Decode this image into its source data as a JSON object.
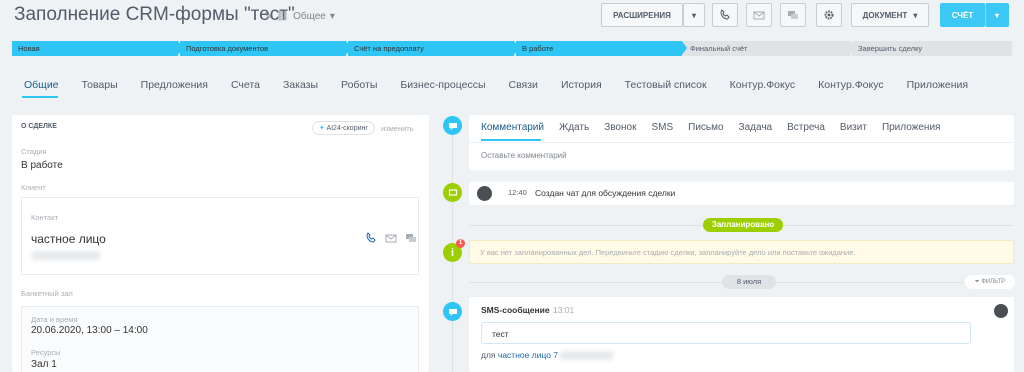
{
  "header": {
    "title": "Заполнение CRM-формы  \"тест\"",
    "category": "Общее",
    "buttons": {
      "extensions": "РАСШИРЕНИЯ",
      "document": "ДОКУМЕНТ",
      "invoice": "СЧЁТ"
    }
  },
  "stages": [
    {
      "label": "Новая",
      "state": "active"
    },
    {
      "label": "Подготовка документов",
      "state": "active"
    },
    {
      "label": "Счёт на предоплату",
      "state": "active"
    },
    {
      "label": "В работе",
      "state": "active"
    },
    {
      "label": "Финальный счёт",
      "state": "inactive"
    },
    {
      "label": "Завершить сделку",
      "state": "inactive"
    }
  ],
  "tabs": [
    "Общие",
    "Товары",
    "Предложения",
    "Счета",
    "Заказы",
    "Роботы",
    "Бизнес-процессы",
    "Связи",
    "История",
    "Тестовый список",
    "Контур.Фокус",
    "Контур.Фокус",
    "Приложения"
  ],
  "left": {
    "section_title": "О СДЕЛКЕ",
    "ai_scoring": "AI24-скоринг",
    "edit": "изменить",
    "stage_label": "Стадия",
    "stage_value": "В работе",
    "client_label": "Клиент",
    "contact_label": "Контакт",
    "contact_name": "частное лицо",
    "banquet_label": "Банкетный зал",
    "datetime_label": "Дата и время",
    "datetime_value": "20.06.2020, 13:00 – 14:00",
    "resources_label": "Ресурсы",
    "resources_value": "Зал 1"
  },
  "timeline": {
    "comment_tabs": [
      "Комментарий",
      "Ждать",
      "Звонок",
      "SMS",
      "Письмо",
      "Задача",
      "Встреча",
      "Визит",
      "Приложения"
    ],
    "comment_placeholder": "Оставьте комментарий",
    "chat_time": "12:40",
    "chat_text": "Создан чат для обсуждения сделки",
    "planned_label": "Запланировано",
    "info_text": "У вас нет запланированных дел. Передвиньте стадию сделки, запланируйте дело или поставьте ожидание.",
    "info_badge": "1",
    "date_label": "8 июля",
    "filter_label": "ФИЛЬТР",
    "sms_title": "SMS-сообщение",
    "sms_time": "13:01",
    "sms_text": "тест",
    "sms_for_prefix": "для",
    "sms_for_name": "частное лицо 7"
  },
  "colors": {
    "accent": "#2fc6f6",
    "stage_inactive": "#dfe3e6",
    "planned": "#9dcf00",
    "chat_dot": "#9dcf00",
    "info_dot": "#9dcf00",
    "comment_dot": "#2fc6f6",
    "badge": "#ff5752"
  }
}
